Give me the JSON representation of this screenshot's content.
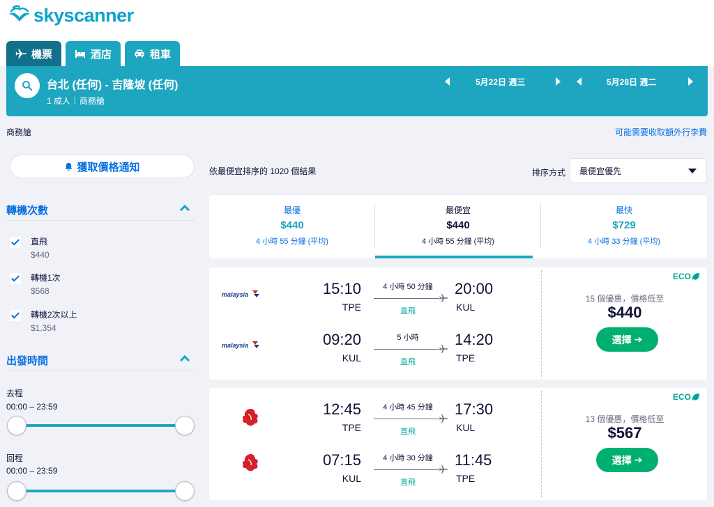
{
  "brand": {
    "name": "skyscanner",
    "color": "#0ea3cc"
  },
  "tabs": [
    {
      "label": "機票",
      "icon": "plane-icon",
      "active": true
    },
    {
      "label": "酒店",
      "icon": "bed-icon",
      "active": false
    },
    {
      "label": "租車",
      "icon": "car-icon",
      "active": false
    }
  ],
  "search": {
    "route": "台北 (任何) - 吉隆坡 (任何)",
    "passengers": "1 成人",
    "cabin": "商務艙",
    "outbound_date": "5月22日 週三",
    "return_date": "5月28日 週二"
  },
  "cabin_label": "商務艙",
  "baggage_notice": "可能需要收取額外行李費",
  "price_alert_label": "獲取價格通知",
  "filters": {
    "stops": {
      "title": "轉機次數",
      "options": [
        {
          "label": "直飛",
          "price": "$440",
          "checked": true
        },
        {
          "label": "轉機1次",
          "price": "$568",
          "checked": true
        },
        {
          "label": "轉機2次以上",
          "price": "$1,354",
          "checked": true
        }
      ]
    },
    "departure": {
      "title": "出發時間",
      "outbound": {
        "label": "去程",
        "range": "00:00 – 23:59"
      },
      "return": {
        "label": "回程",
        "range": "00:00 – 23:59"
      }
    }
  },
  "results": {
    "count_text": "依最便宜排序的 1020 個結果",
    "sort_label": "排序方式",
    "sort_value": "最便宜優先"
  },
  "summary": [
    {
      "name": "最優",
      "price": "$440",
      "time": "4 小時 55 分鐘 (平均)"
    },
    {
      "name": "最便宜",
      "price": "$440",
      "time": "4 小時 55 分鐘 (平均)",
      "selected": true
    },
    {
      "name": "最快",
      "price": "$729",
      "time": "4 小時 33 分鐘 (平均)"
    }
  ],
  "cards": [
    {
      "airline": "malaysia",
      "eco": "ECO",
      "deals": "15 個優惠，價格低至",
      "price": "$440",
      "select_label": "選擇",
      "legs": [
        {
          "dep": "15:10",
          "dep_code": "TPE",
          "arr": "20:00",
          "arr_code": "KUL",
          "duration": "4 小時 50 分鐘",
          "stops": "直飛"
        },
        {
          "dep": "09:20",
          "dep_code": "KUL",
          "arr": "14:20",
          "arr_code": "TPE",
          "duration": "5 小時",
          "stops": "直飛"
        }
      ]
    },
    {
      "airline": "malindo",
      "eco": "ECO",
      "deals": "13 個優惠，價格低至",
      "price": "$567",
      "select_label": "選擇",
      "legs": [
        {
          "dep": "12:45",
          "dep_code": "TPE",
          "arr": "17:30",
          "arr_code": "KUL",
          "duration": "4 小時 45 分鐘",
          "stops": "直飛"
        },
        {
          "dep": "07:15",
          "dep_code": "KUL",
          "arr": "11:45",
          "arr_code": "TPE",
          "duration": "4 小時 30 分鐘",
          "stops": "直飛"
        }
      ]
    }
  ],
  "colors": {
    "teal": "#1ea6c0",
    "dark_teal": "#11708a",
    "blue": "#0770e3",
    "green": "#00b070",
    "eco_green": "#00a698"
  }
}
